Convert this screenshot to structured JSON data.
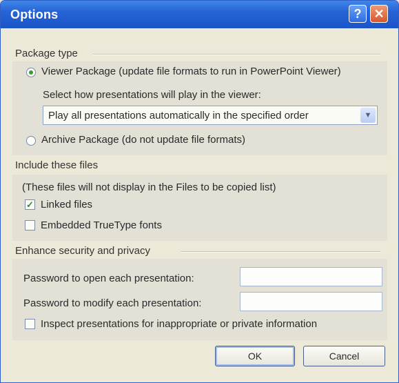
{
  "window": {
    "title": "Options",
    "help_icon": "?",
    "close_icon": "✕"
  },
  "package_type": {
    "heading": "Package type",
    "viewer_option": "Viewer Package (update file formats to run in PowerPoint Viewer)",
    "select_label": "Select how presentations will play in the viewer:",
    "select_value": "Play all presentations automatically in the specified order",
    "archive_option": "Archive Package (do not update file formats)"
  },
  "include_files": {
    "heading": "Include these files",
    "note": "(These files will not display in the Files to be copied list)",
    "linked_files": "Linked files",
    "embedded_fonts": "Embedded TrueType fonts",
    "check_mark": "✓"
  },
  "security": {
    "heading": "Enhance security and privacy",
    "password_open_label": "Password to open each presentation:",
    "password_modify_label": "Password to modify each presentation:",
    "inspect_label": "Inspect presentations for inappropriate or private information"
  },
  "buttons": {
    "ok": "OK",
    "cancel": "Cancel"
  }
}
